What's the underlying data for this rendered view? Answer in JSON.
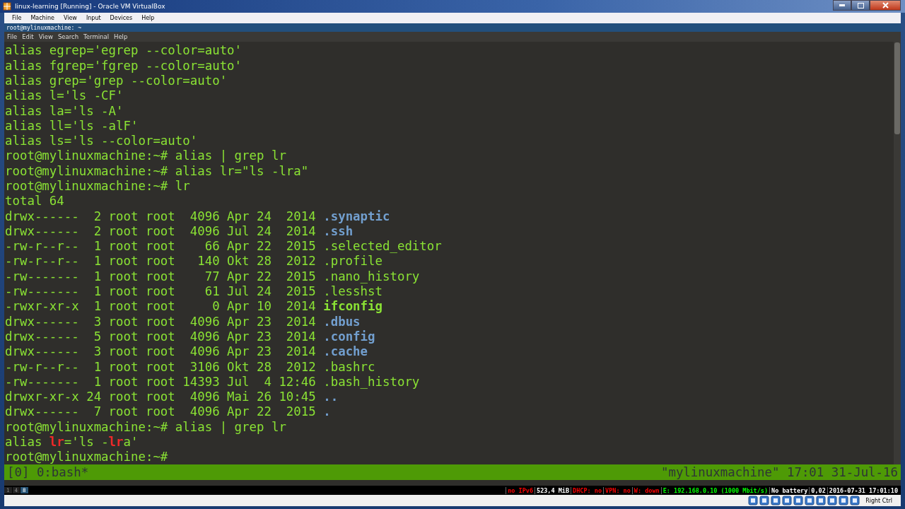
{
  "window": {
    "title": "linux-learning [Running] - Oracle VM VirtualBox"
  },
  "vbox_menu": [
    "File",
    "Machine",
    "View",
    "Input",
    "Devices",
    "Help"
  ],
  "terminal_window": {
    "title": "root@mylinuxmachine: ~"
  },
  "terminal_menu": [
    "File",
    "Edit",
    "View",
    "Search",
    "Terminal",
    "Help"
  ],
  "terminal_lines": [
    {
      "segments": [
        {
          "text": "alias egrep='egrep --color=auto'",
          "kind": "plain"
        }
      ]
    },
    {
      "segments": [
        {
          "text": "alias fgrep='fgrep --color=auto'",
          "kind": "plain"
        }
      ]
    },
    {
      "segments": [
        {
          "text": "alias grep='grep --color=auto'",
          "kind": "plain"
        }
      ]
    },
    {
      "segments": [
        {
          "text": "alias l='ls -CF'",
          "kind": "plain"
        }
      ]
    },
    {
      "segments": [
        {
          "text": "alias la='ls -A'",
          "kind": "plain"
        }
      ]
    },
    {
      "segments": [
        {
          "text": "alias ll='ls -alF'",
          "kind": "plain"
        }
      ]
    },
    {
      "segments": [
        {
          "text": "alias ls='ls --color=auto'",
          "kind": "plain"
        }
      ]
    },
    {
      "segments": [
        {
          "text": "root@mylinuxmachine:~# alias | grep lr",
          "kind": "plain"
        }
      ]
    },
    {
      "segments": [
        {
          "text": "root@mylinuxmachine:~# alias lr=\"ls -lra\"",
          "kind": "plain"
        }
      ]
    },
    {
      "segments": [
        {
          "text": "root@mylinuxmachine:~# lr",
          "kind": "plain"
        }
      ]
    },
    {
      "segments": [
        {
          "text": "total 64",
          "kind": "plain"
        }
      ]
    },
    {
      "segments": [
        {
          "text": "drwx------  2 root root  4096 Apr 24  2014 ",
          "kind": "plain"
        },
        {
          "text": ".synaptic",
          "kind": "dir"
        }
      ]
    },
    {
      "segments": [
        {
          "text": "drwx------  2 root root  4096 Jul 24  2014 ",
          "kind": "plain"
        },
        {
          "text": ".ssh",
          "kind": "dir"
        }
      ]
    },
    {
      "segments": [
        {
          "text": "-rw-r--r--  1 root root    66 Apr 22  2015 .selected_editor",
          "kind": "plain"
        }
      ]
    },
    {
      "segments": [
        {
          "text": "-rw-r--r--  1 root root   140 Okt 28  2012 .profile",
          "kind": "plain"
        }
      ]
    },
    {
      "segments": [
        {
          "text": "-rw-------  1 root root    77 Apr 22  2015 .nano_history",
          "kind": "plain"
        }
      ]
    },
    {
      "segments": [
        {
          "text": "-rw-------  1 root root    61 Jul 24  2015 .lesshst",
          "kind": "plain"
        }
      ]
    },
    {
      "segments": [
        {
          "text": "-rwxr-xr-x  1 root root     0 Apr 10  2014 ",
          "kind": "plain"
        },
        {
          "text": "ifconfig",
          "kind": "exec"
        }
      ]
    },
    {
      "segments": [
        {
          "text": "drwx------  3 root root  4096 Apr 23  2014 ",
          "kind": "plain"
        },
        {
          "text": ".dbus",
          "kind": "dir"
        }
      ]
    },
    {
      "segments": [
        {
          "text": "drwx------  5 root root  4096 Apr 23  2014 ",
          "kind": "plain"
        },
        {
          "text": ".config",
          "kind": "dir"
        }
      ]
    },
    {
      "segments": [
        {
          "text": "drwx------  3 root root  4096 Apr 23  2014 ",
          "kind": "plain"
        },
        {
          "text": ".cache",
          "kind": "dir"
        }
      ]
    },
    {
      "segments": [
        {
          "text": "-rw-r--r--  1 root root  3106 Okt 28  2012 .bashrc",
          "kind": "plain"
        }
      ]
    },
    {
      "segments": [
        {
          "text": "-rw-------  1 root root 14393 Jul  4 12:46 .bash_history",
          "kind": "plain"
        }
      ]
    },
    {
      "segments": [
        {
          "text": "drwxr-xr-x 24 root root  4096 Mai 26 10:45 ",
          "kind": "plain"
        },
        {
          "text": "..",
          "kind": "dir"
        }
      ]
    },
    {
      "segments": [
        {
          "text": "drwx------  7 root root  4096 Apr 22  2015 ",
          "kind": "plain"
        },
        {
          "text": ".",
          "kind": "dir"
        }
      ]
    },
    {
      "segments": [
        {
          "text": "root@mylinuxmachine:~# alias | grep lr",
          "kind": "plain"
        }
      ]
    },
    {
      "segments": [
        {
          "text": "alias ",
          "kind": "plain"
        },
        {
          "text": "lr",
          "kind": "match"
        },
        {
          "text": "='ls -",
          "kind": "plain"
        },
        {
          "text": "lr",
          "kind": "match"
        },
        {
          "text": "a'",
          "kind": "plain"
        }
      ]
    },
    {
      "segments": [
        {
          "text": "root@mylinuxmachine:~#",
          "kind": "plain"
        }
      ]
    }
  ],
  "tmux_status": {
    "left": "[0] 0:bash*",
    "right": "\"mylinuxmachine\" 17:01 31-Jul-16"
  },
  "i3bar": {
    "workspaces": [
      {
        "label": "1",
        "selected": false
      },
      {
        "label": "4",
        "selected": false
      },
      {
        "label": "8",
        "selected": true
      }
    ],
    "status": [
      {
        "text": "no IPv6",
        "kind": "bad"
      },
      {
        "text": "523,4 MiB",
        "kind": "info"
      },
      {
        "text": "DHCP: no",
        "kind": "bad"
      },
      {
        "text": "VPN: no",
        "kind": "bad"
      },
      {
        "text": "W: down",
        "kind": "bad"
      },
      {
        "text": "E: 192.168.0.10 (1000 Mbit/s)",
        "kind": "good"
      },
      {
        "text": "No battery",
        "kind": "info"
      },
      {
        "text": "0,02",
        "kind": "info"
      },
      {
        "text": "2016-07-31 17:01:10",
        "kind": "info"
      }
    ]
  },
  "vbox_status": {
    "host_key": "Right Ctrl"
  }
}
